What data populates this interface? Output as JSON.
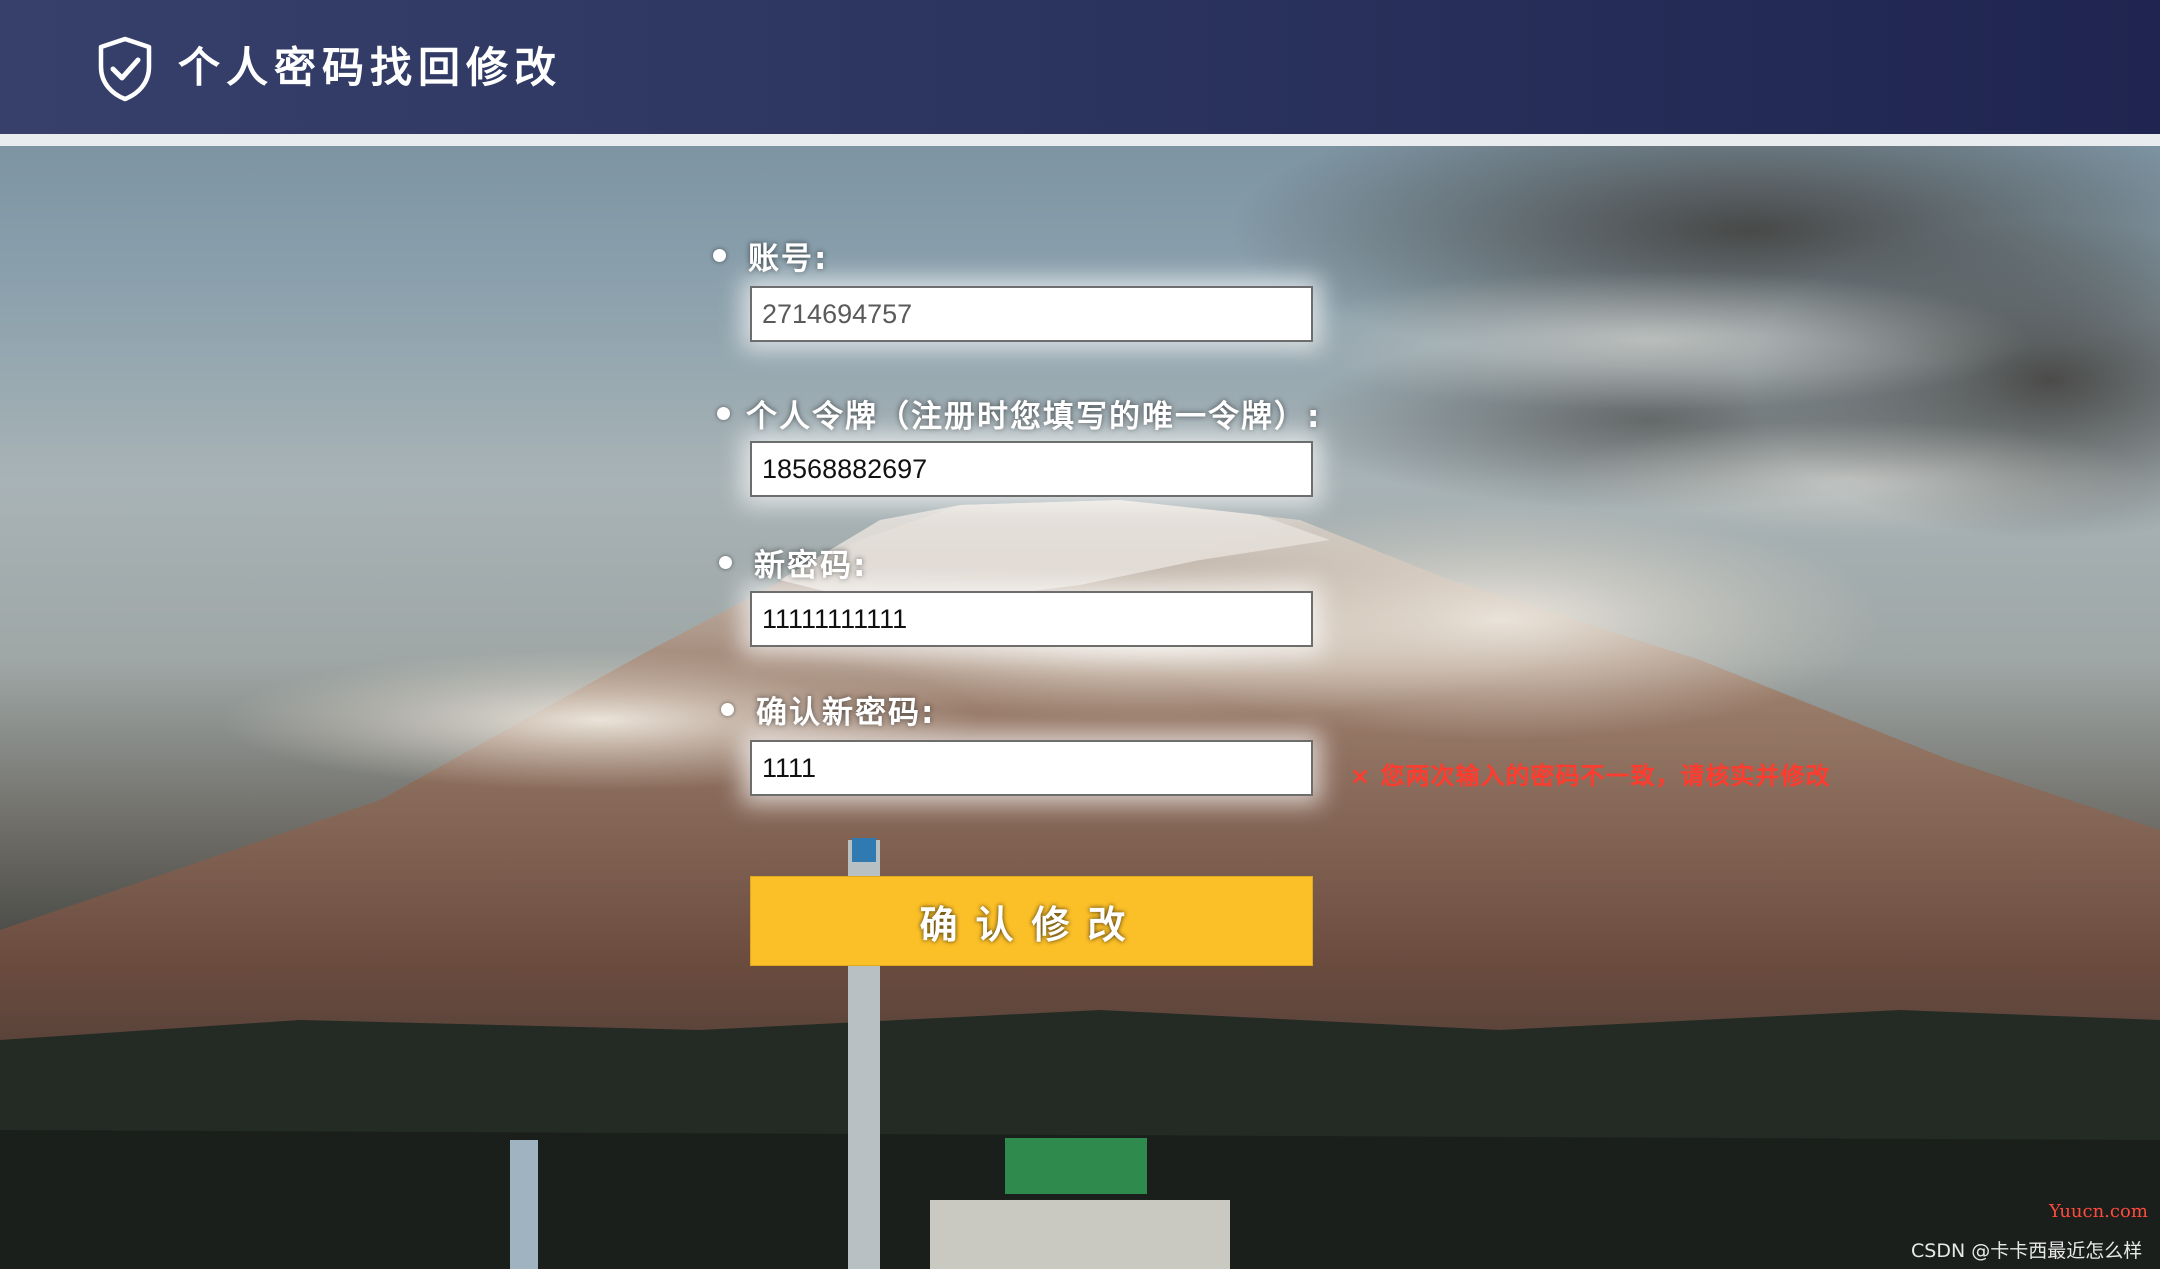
{
  "header": {
    "title": "个人密码找回修改",
    "icon": "shield-check-icon"
  },
  "form": {
    "account": {
      "label": "账号:",
      "value": "2714694757"
    },
    "token": {
      "label": "个人令牌（注册时您填写的唯一令牌）:",
      "value": "18568882697"
    },
    "new_password": {
      "label": "新密码:",
      "value": "11111111111"
    },
    "confirm_password": {
      "label": "确认新密码:",
      "value": "1111"
    },
    "error": "× 您两次输入的密码不一致，请核实并修改",
    "submit_label": "确认修改"
  },
  "watermark": {
    "site": "Yuucn.com",
    "csdn": "CSDN @卡卡西最近怎么样"
  },
  "colors": {
    "header_bg": "#2c3560",
    "button": "#fbbf28",
    "error": "#ff3b2e"
  }
}
